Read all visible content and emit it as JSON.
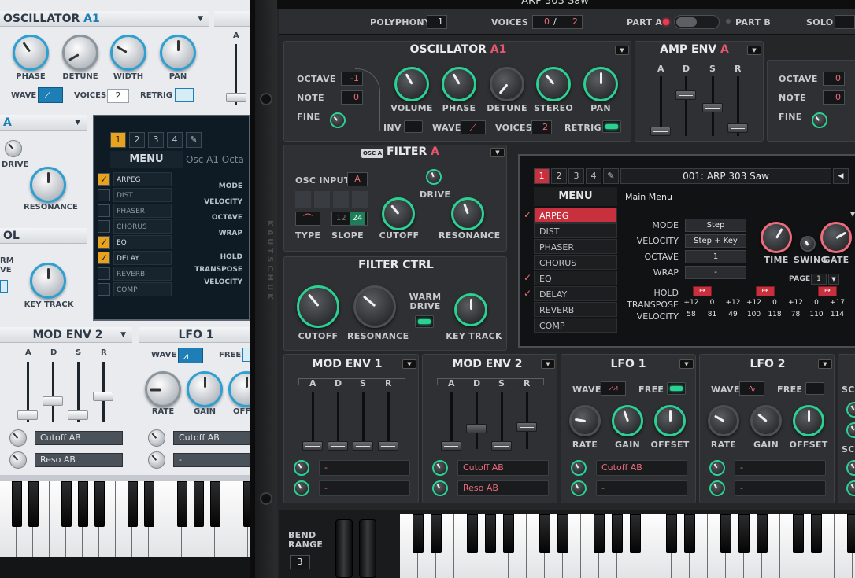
{
  "window_title": "ARP 303 Saw",
  "left": {
    "osc_title": "OSCILLATOR",
    "osc_part": "A1",
    "knobs": [
      "PHASE",
      "DETUNE",
      "WIDTH",
      "PAN"
    ],
    "wave_label": "WAVE",
    "voices_label": "VOICES",
    "voices_value": "2",
    "retrig_label": "RETRIG",
    "amp_fader_label": "A",
    "filter_part": "A",
    "drive_label": "DRIVE",
    "resonance_label": "RESONANCE",
    "ctrl_title": "OL",
    "warm_drive_label1": "RM",
    "warm_drive_label2": "VE",
    "key_track_label": "KEY TRACK",
    "tabs": [
      "1",
      "2",
      "3",
      "4"
    ],
    "menu_title": "MENU",
    "preset_partial": "Osc A1 Octa",
    "menu_items": [
      "ARPEG",
      "DIST",
      "PHASER",
      "CHORUS",
      "EQ",
      "DELAY",
      "REVERB",
      "COMP"
    ],
    "menu_checked": [
      true,
      false,
      false,
      false,
      true,
      true,
      false,
      false
    ],
    "params": [
      "MODE",
      "VELOCITY",
      "OCTAVE",
      "WRAP",
      "HOLD",
      "TRANSPOSE",
      "VELOCITY"
    ],
    "mod_env_title": "MOD ENV 2",
    "adsr": [
      "A",
      "D",
      "S",
      "R"
    ],
    "lfo_title": "LFO 1",
    "lfo_wave_label": "WAVE",
    "lfo_free_label": "FREE",
    "lfo_knobs": [
      "RATE",
      "GAIN",
      "OFFS"
    ],
    "mod_sel_1": "Cutoff AB",
    "mod_sel_2": "Reso AB",
    "lfo_sel_1": "Cutoff AB",
    "lfo_sel_2": "-"
  },
  "right": {
    "side_brand": "KAUTSCHUK",
    "top": {
      "polyphony_label": "POLYPHONY",
      "polyphony_value": "1",
      "voices_label": "VOICES",
      "voices_value_a": "0",
      "voices_sep": "/",
      "voices_value_b": "2",
      "part_a_label": "PART A",
      "part_b_label": "PART B",
      "solo_label": "SOLO"
    },
    "osc": {
      "title": "OSCILLATOR",
      "part": "A1",
      "octave_label": "OCTAVE",
      "octave_value": "-1",
      "note_label": "NOTE",
      "note_value": "0",
      "fine_label": "FINE",
      "knobs": [
        "VOLUME",
        "PHASE",
        "DETUNE",
        "STEREO",
        "PAN"
      ],
      "inv_label": "INV",
      "wave_label": "WAVE",
      "voices_label": "VOICES",
      "voices_value": "2",
      "retrig_label": "RETRIG"
    },
    "amp_env": {
      "title": "AMP ENV",
      "part": "A",
      "adsr": [
        "A",
        "D",
        "S",
        "R"
      ]
    },
    "osc2": {
      "octave_label": "OCTAVE",
      "octave_value": "0",
      "note_label": "NOTE",
      "note_value": "0",
      "fine_label": "FINE"
    },
    "filter": {
      "badge": "OSC A",
      "title": "FILTER",
      "part": "A",
      "osc_input_label": "OSC INPUT",
      "osc_input_value": "A",
      "drive_label": "DRIVE",
      "type_label": "TYPE",
      "slope_label": "SLOPE",
      "slope_value_a": "12",
      "slope_value_b": "24",
      "cutoff_label": "CUTOFF",
      "resonance_label": "RESONANCE"
    },
    "filter_ctrl": {
      "title": "FILTER CTRL",
      "cutoff_label": "CUTOFF",
      "resonance_label": "RESONANCE",
      "warm_label": "WARM",
      "drive_label": "DRIVE",
      "key_track_label": "KEY TRACK"
    },
    "display": {
      "tabs": [
        "1",
        "2",
        "3",
        "4"
      ],
      "preset": "001: ARP 303 Saw",
      "menu_title": "MENU",
      "sub_title": "Main Menu",
      "menu_items": [
        "ARPEG",
        "DIST",
        "PHASER",
        "CHORUS",
        "EQ",
        "DELAY",
        "REVERB",
        "COMP"
      ],
      "menu_checked": [
        true,
        false,
        false,
        false,
        true,
        true,
        false,
        false
      ],
      "mode_label": "MODE",
      "mode_value": "Step",
      "velocity_label": "VELOCITY",
      "velocity_value": "Step + Key",
      "octave_label": "OCTAVE",
      "octave_value": "1",
      "wrap_label": "WRAP",
      "wrap_value": "-",
      "time_label": "TIME",
      "swing_label": "SWING",
      "gate_label": "GATE",
      "page_label": "PAGE",
      "page_value": "1",
      "hold_label": "HOLD",
      "transpose_label": "TRANSPOSE",
      "velocity2_label": "VELOCITY",
      "hold_steps": [
        true,
        false,
        false,
        true,
        false,
        false,
        true
      ],
      "transpose_values": [
        "+12",
        "0",
        "+12",
        "+12",
        "0",
        "+12",
        "0",
        "+17"
      ],
      "velocity_values": [
        "58",
        "81",
        "49",
        "100",
        "118",
        "78",
        "110",
        "114"
      ]
    },
    "mod_env1": {
      "title": "MOD ENV 1",
      "adsr": [
        "A",
        "D",
        "S",
        "R"
      ],
      "sel1": "-",
      "sel2": "-"
    },
    "mod_env2": {
      "title": "MOD ENV 2",
      "adsr": [
        "A",
        "D",
        "S",
        "R"
      ],
      "sel1": "Cutoff AB",
      "sel2": "Reso AB"
    },
    "lfo1": {
      "title": "LFO 1",
      "wave_label": "WAVE",
      "free_label": "FREE",
      "knobs": [
        "RATE",
        "GAIN",
        "OFFSET"
      ],
      "sel1": "Cutoff AB",
      "sel2": "-"
    },
    "lfo2": {
      "title": "LFO 2",
      "wave_label": "WAVE",
      "free_label": "FREE",
      "knobs": [
        "RATE",
        "GAIN",
        "OFFSET"
      ],
      "sel1": "-",
      "sel2": "-"
    },
    "edge_labels": [
      "SC",
      "SC"
    ],
    "bend_label1": "BEND",
    "bend_label2": "RANGE",
    "bend_value": "3"
  },
  "colors": {
    "accent_green": "#2bd193",
    "accent_red": "#ec6b7d",
    "accent_blue": "#1d7fb5",
    "amber": "#e8a21c"
  }
}
